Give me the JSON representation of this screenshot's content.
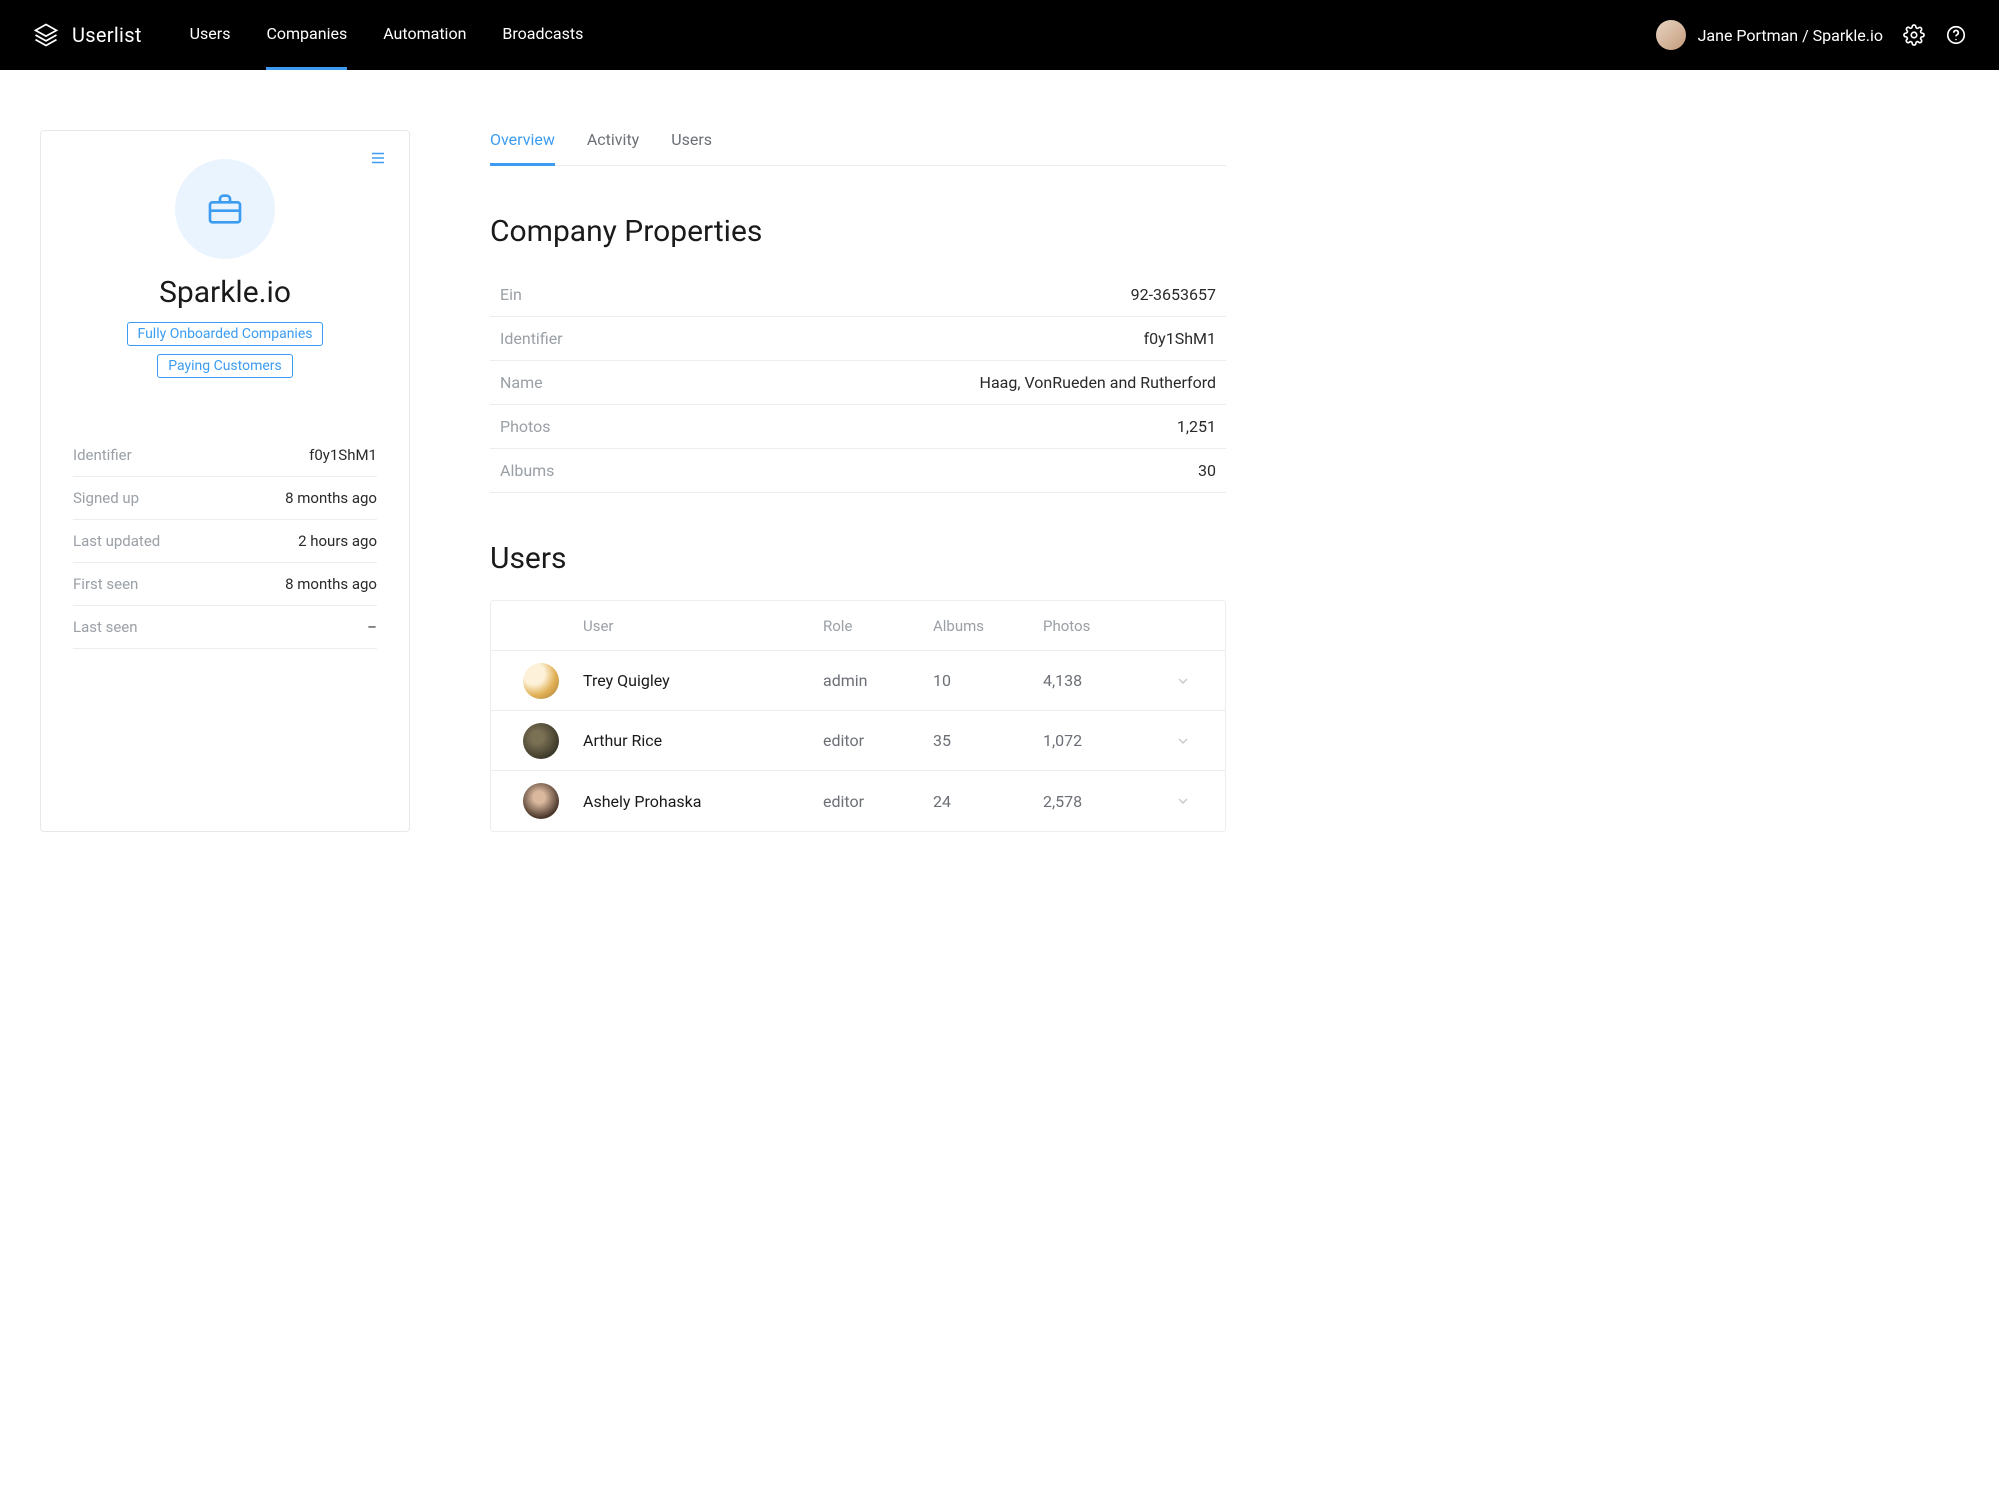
{
  "brand": "Userlist",
  "nav": {
    "items": [
      {
        "label": "Users"
      },
      {
        "label": "Companies"
      },
      {
        "label": "Automation"
      },
      {
        "label": "Broadcasts"
      }
    ],
    "activeIndex": 1
  },
  "currentUser": "Jane Portman / Sparkle.io",
  "company": {
    "name": "Sparkle.io",
    "tags": [
      "Fully Onboarded Companies",
      "Paying Customers"
    ],
    "meta": [
      {
        "label": "Identifier",
        "value": "f0y1ShM1"
      },
      {
        "label": "Signed up",
        "value": "8 months ago"
      },
      {
        "label": "Last updated",
        "value": "2 hours ago"
      },
      {
        "label": "First seen",
        "value": "8 months ago"
      },
      {
        "label": "Last seen",
        "value": "–"
      }
    ]
  },
  "tabs": [
    {
      "label": "Overview"
    },
    {
      "label": "Activity"
    },
    {
      "label": "Users"
    }
  ],
  "tabsActiveIndex": 0,
  "sections": {
    "propertiesTitle": "Company Properties",
    "usersTitle": "Users"
  },
  "properties": [
    {
      "label": "Ein",
      "value": "92-3653657"
    },
    {
      "label": "Identifier",
      "value": "f0y1ShM1"
    },
    {
      "label": "Name",
      "value": "Haag, VonRueden and Rutherford"
    },
    {
      "label": "Photos",
      "value": "1,251"
    },
    {
      "label": "Albums",
      "value": "30"
    }
  ],
  "usersTable": {
    "headers": {
      "user": "User",
      "role": "Role",
      "albums": "Albums",
      "photos": "Photos"
    },
    "rows": [
      {
        "name": "Trey Quigley",
        "role": "admin",
        "albums": "10",
        "photos": "4,138"
      },
      {
        "name": "Arthur Rice",
        "role": "editor",
        "albums": "35",
        "photos": "1,072"
      },
      {
        "name": "Ashely Prohaska",
        "role": "editor",
        "albums": "24",
        "photos": "2,578"
      }
    ]
  }
}
